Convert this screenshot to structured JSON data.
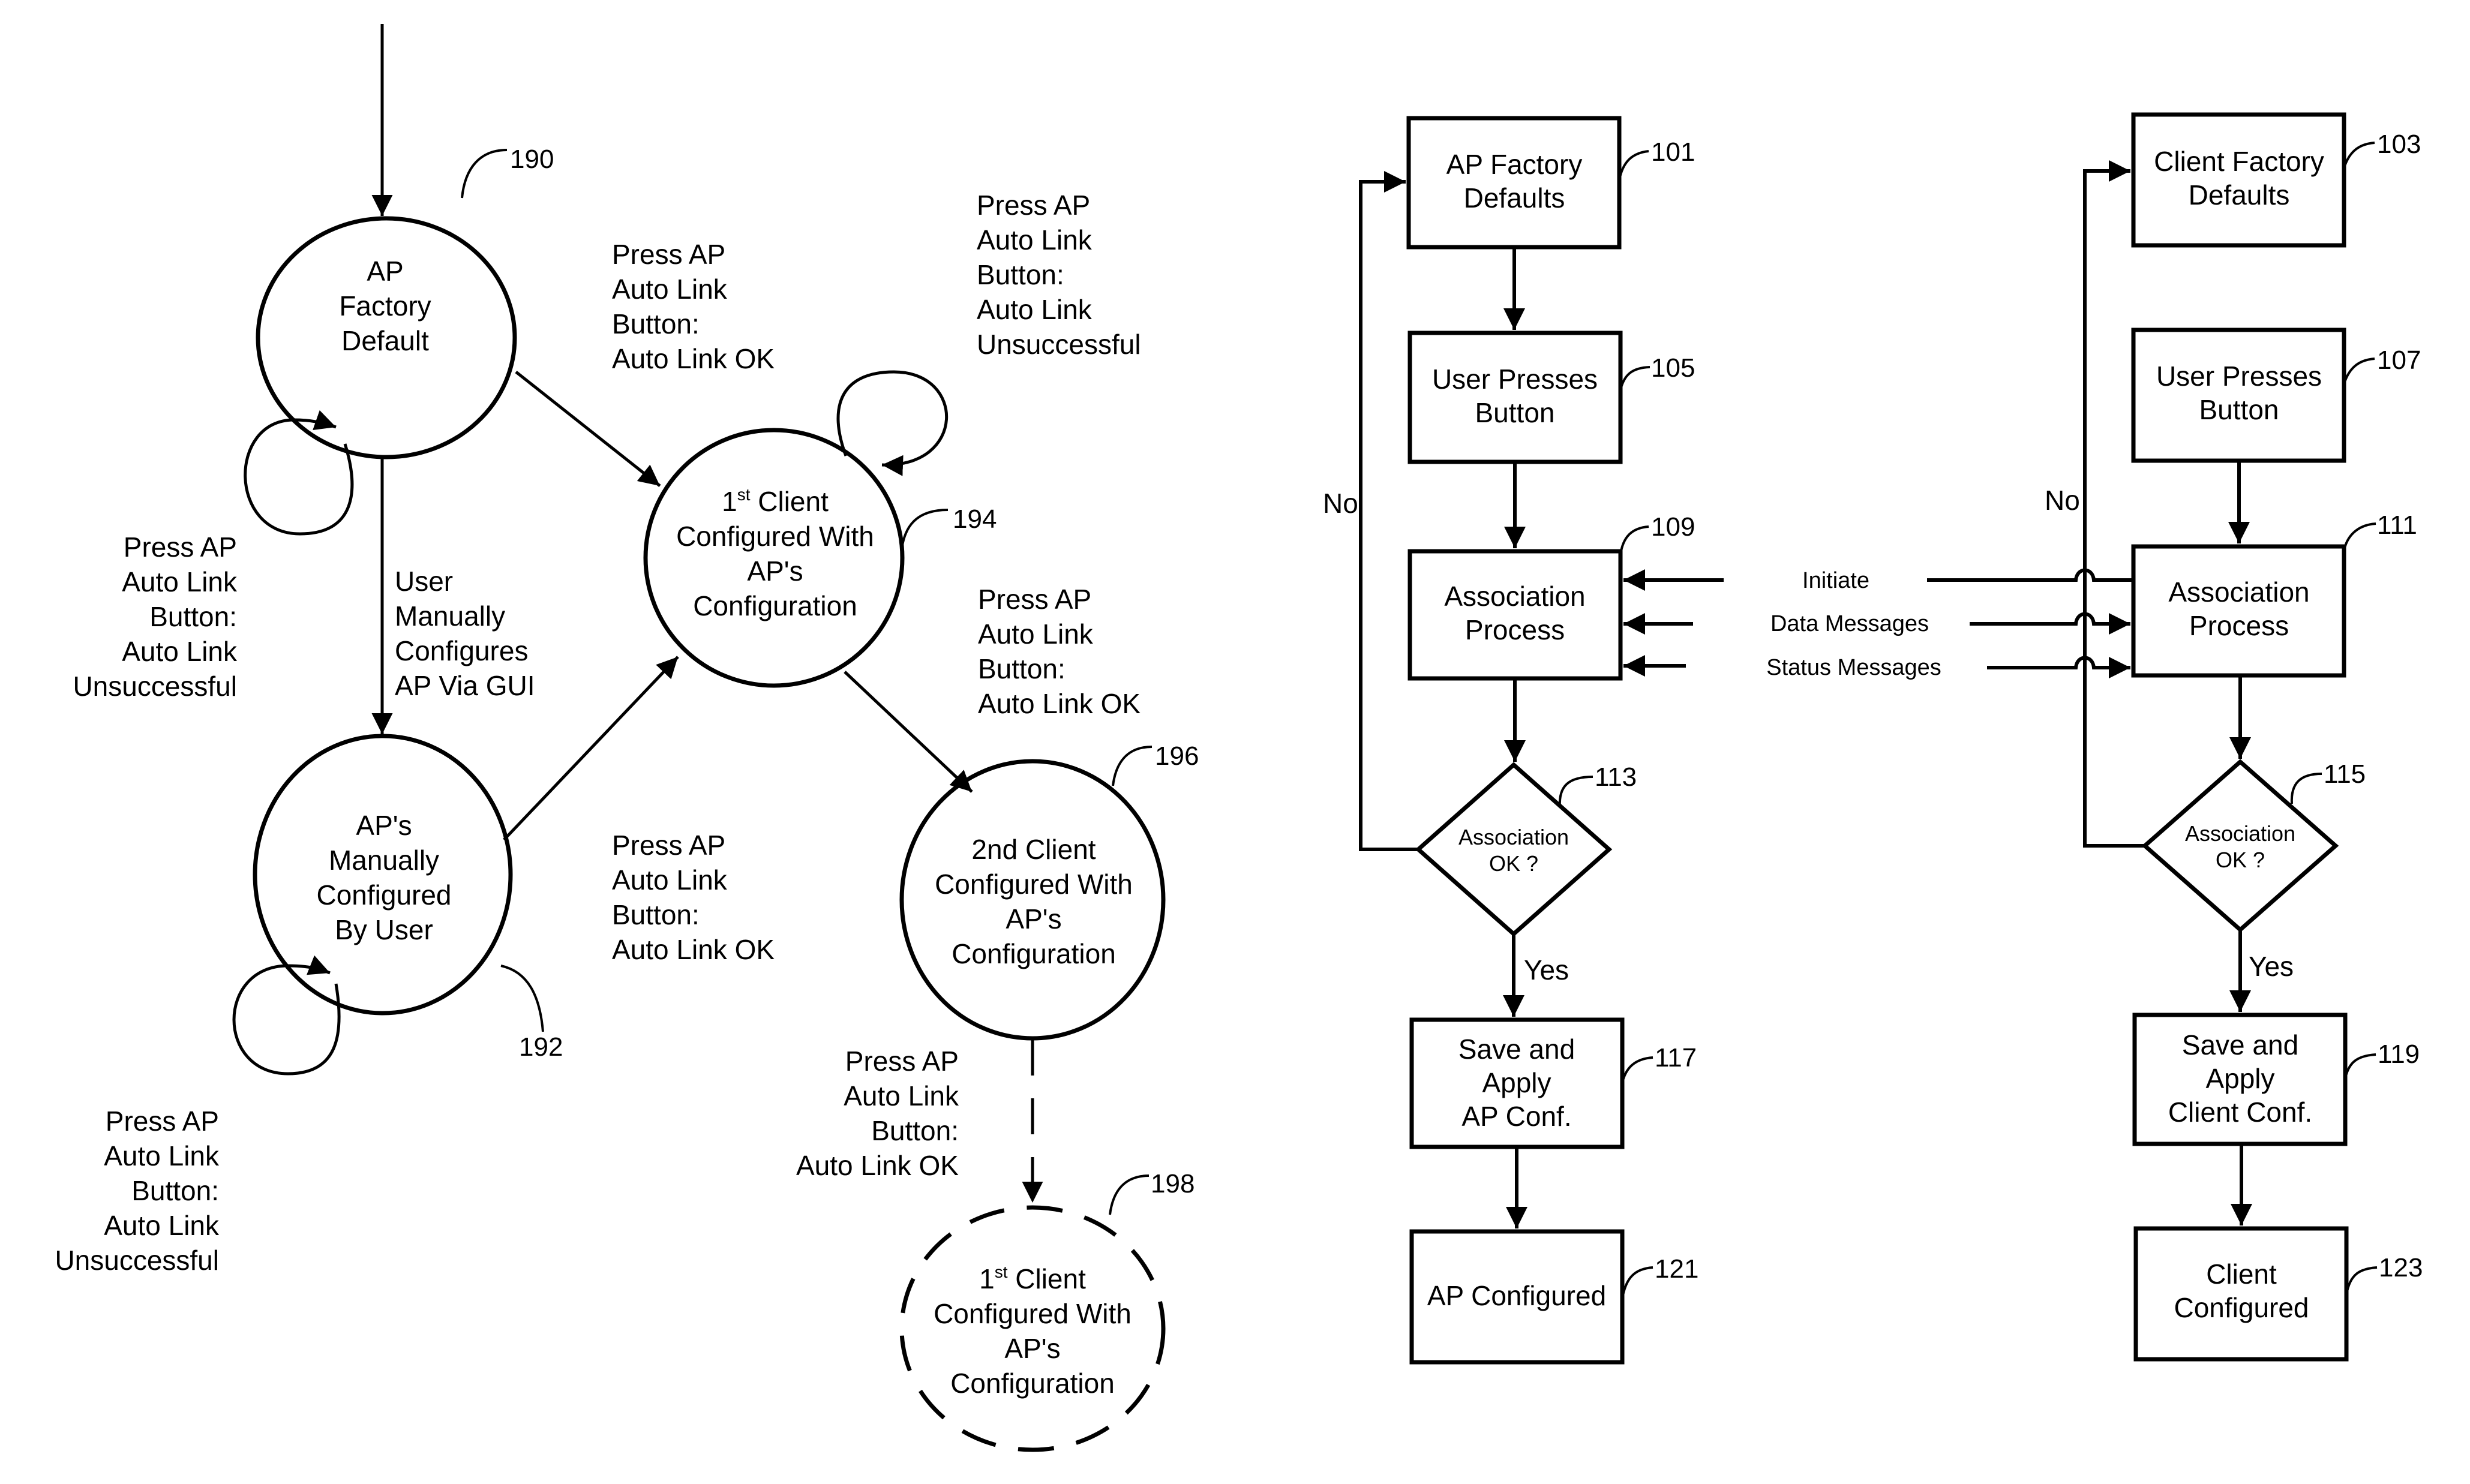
{
  "state_diagram": {
    "states": [
      {
        "id": "190",
        "ref": "190",
        "lines": [
          "AP",
          "Factory",
          "Default"
        ],
        "style": "solid"
      },
      {
        "id": "192",
        "ref": "192",
        "lines": [
          "AP's",
          "Manually",
          "Configured",
          "By User"
        ],
        "style": "solid"
      },
      {
        "id": "194",
        "ref": "194",
        "lines": [
          "1st Client",
          "Configured With",
          "AP's",
          "Configuration"
        ],
        "style": "solid",
        "superscript_first": true
      },
      {
        "id": "196",
        "ref": "196",
        "lines": [
          "2nd Client",
          "Configured With",
          "AP's",
          "Configuration"
        ],
        "style": "solid"
      },
      {
        "id": "198",
        "ref": "198",
        "lines": [
          "1st Client",
          "Configured With",
          "AP's",
          "Configuration"
        ],
        "style": "dashed",
        "superscript_first": true
      }
    ],
    "transitions": [
      {
        "from": "start",
        "to": "190",
        "label": []
      },
      {
        "from": "190",
        "to": "190",
        "label": [
          "Press  AP",
          "Auto Link",
          "Button:",
          "Auto Link",
          "Unsuccessful"
        ]
      },
      {
        "from": "190",
        "to": "194",
        "label": [
          "Press  AP",
          "Auto Link",
          "Button:",
          "Auto Link OK"
        ]
      },
      {
        "from": "190",
        "to": "192",
        "label": [
          "User",
          "Manually",
          "Configures",
          "AP Via GUI"
        ]
      },
      {
        "from": "194",
        "to": "194",
        "label": [
          "Press  AP",
          "Auto Link",
          "Button:",
          "Auto Link",
          "Unsuccessful"
        ]
      },
      {
        "from": "194",
        "to": "196",
        "label": [
          "Press  AP",
          "Auto Link",
          "Button:",
          "Auto Link OK"
        ]
      },
      {
        "from": "192",
        "to": "194",
        "label": [
          "Press  AP",
          "Auto Link",
          "Button:",
          "Auto Link OK"
        ]
      },
      {
        "from": "192",
        "to": "192",
        "label": [
          "Press  AP",
          "Auto Link",
          "Button:",
          "Auto Link",
          "Unsuccessful"
        ]
      },
      {
        "from": "196",
        "to": "198",
        "label": [
          "Press  AP",
          "Auto Link",
          "Button:",
          "Auto Link OK"
        ],
        "style": "dashed"
      }
    ]
  },
  "ap_flow": {
    "boxes": [
      {
        "ref": "101",
        "lines": [
          "AP Factory",
          "Defaults"
        ]
      },
      {
        "ref": "105",
        "lines": [
          "User Presses",
          "Button"
        ]
      },
      {
        "ref": "109",
        "lines": [
          "Association",
          "Process"
        ]
      },
      {
        "ref": "117",
        "lines": [
          "Save and",
          "Apply",
          "AP Conf."
        ]
      },
      {
        "ref": "121",
        "lines": [
          "AP Configured"
        ]
      }
    ],
    "decision": {
      "ref": "113",
      "lines": [
        "Association",
        "OK ?"
      ]
    },
    "yes_label": "Yes",
    "no_label": "No"
  },
  "client_flow": {
    "boxes": [
      {
        "ref": "103",
        "lines": [
          "Client Factory",
          "Defaults"
        ]
      },
      {
        "ref": "107",
        "lines": [
          "User Presses",
          "Button"
        ]
      },
      {
        "ref": "111",
        "lines": [
          "Association",
          "Process"
        ]
      },
      {
        "ref": "119",
        "lines": [
          "Save and",
          "Apply",
          "Client Conf."
        ]
      },
      {
        "ref": "123",
        "lines": [
          "Client",
          "Configured"
        ]
      }
    ],
    "decision": {
      "ref": "115",
      "lines": [
        "Association",
        "OK ?"
      ]
    },
    "yes_label": "Yes",
    "no_label": "No"
  },
  "messages": [
    "Initiate",
    "Data Messages",
    "Status Messages"
  ]
}
